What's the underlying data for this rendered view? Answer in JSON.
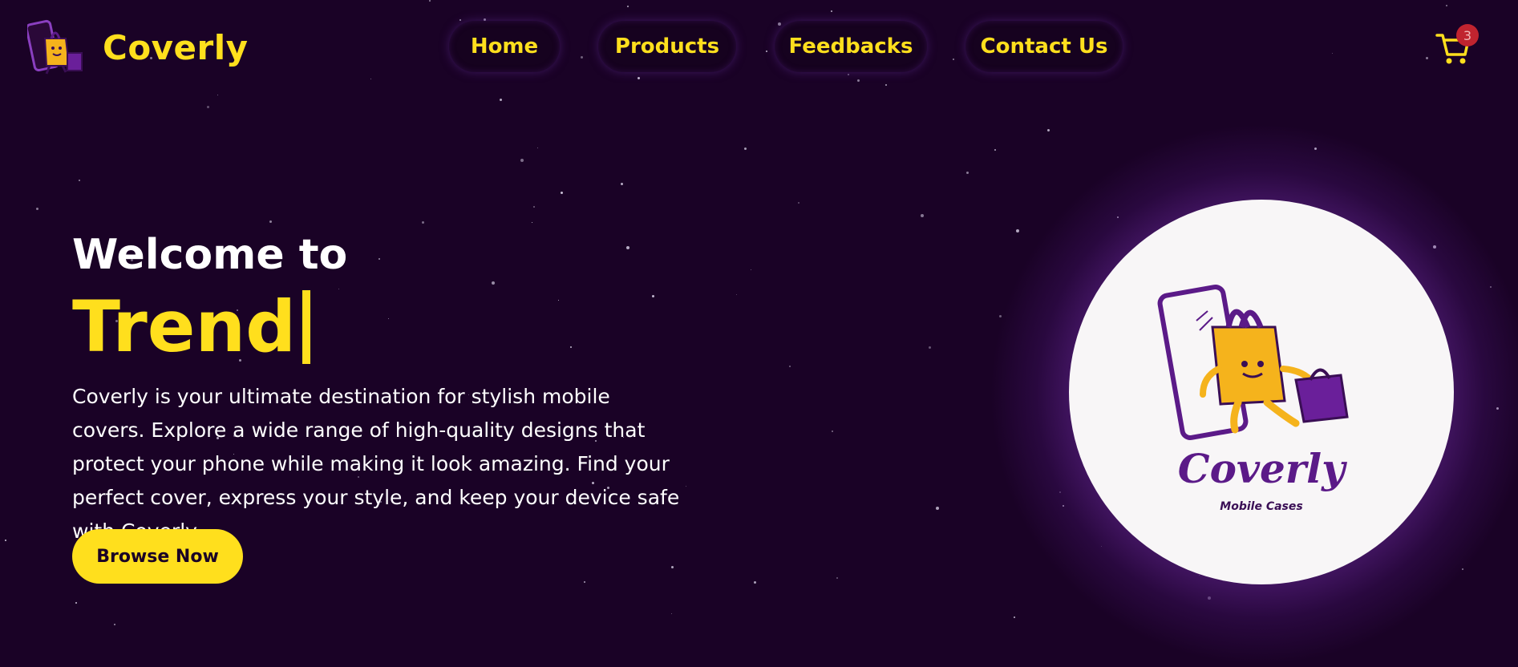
{
  "header": {
    "brand": "Coverly",
    "nav": [
      {
        "label": "Home"
      },
      {
        "label": "Products"
      },
      {
        "label": "Feedbacks"
      },
      {
        "label": "Contact Us"
      }
    ],
    "cart_count": "3",
    "cart_icon": "cart-icon"
  },
  "hero": {
    "welcome": "Welcome to",
    "typed_word": "Trend",
    "description": "Coverly is your ultimate destination for stylish mobile covers. Explore a wide range of high-quality designs that protect your phone while making it look amazing. Find your perfect cover, express your style, and keep your device safe with Coverly.",
    "cta": "Browse Now"
  },
  "logo": {
    "title": "Coverly",
    "subtitle": "Mobile Cases"
  },
  "colors": {
    "background": "#1a0226",
    "accent": "#ffdf1d",
    "purple": "#5b1a88"
  }
}
